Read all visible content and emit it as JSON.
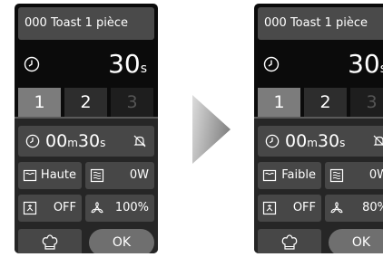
{
  "left_screen": {
    "program_title": "000 Toast 1 pièce",
    "timer_value": "30",
    "timer_unit": "s",
    "steps": [
      {
        "label": "1",
        "state": "active"
      },
      {
        "label": "2",
        "state": "normal"
      },
      {
        "label": "3",
        "state": "disabled"
      }
    ],
    "duration": {
      "minutes": "00",
      "minutes_unit": "m",
      "seconds": "30",
      "seconds_unit": "s"
    },
    "grill_level": "Haute",
    "microwave_power": "0W",
    "steam": "OFF",
    "fan_speed": "100%",
    "ok_label": "OK"
  },
  "right_screen": {
    "program_title": "000 Toast 1 pièce",
    "timer_value": "30",
    "timer_unit": "s",
    "steps": [
      {
        "label": "1",
        "state": "active"
      },
      {
        "label": "2",
        "state": "normal"
      },
      {
        "label": "3",
        "state": "disabled"
      }
    ],
    "duration": {
      "minutes": "00",
      "minutes_unit": "m",
      "seconds": "30",
      "seconds_unit": "s"
    },
    "grill_level": "Faible",
    "microwave_power": "0W",
    "steam": "OFF",
    "fan_speed": "80%",
    "ok_label": "OK"
  },
  "colors": {
    "screen_bg": "#0b0b0b",
    "box_bg": "#474747",
    "active_tab": "#7c7c7c",
    "ok_button": "#6f6f6f",
    "arrow_light": "#d6d6d6",
    "arrow_dark": "#8a8a8a"
  },
  "icons": [
    "clock-icon",
    "bell-off-icon",
    "grill-icon",
    "microwave-icon",
    "steam-icon",
    "fan-icon",
    "chef-hat-icon",
    "next-arrow-icon"
  ]
}
